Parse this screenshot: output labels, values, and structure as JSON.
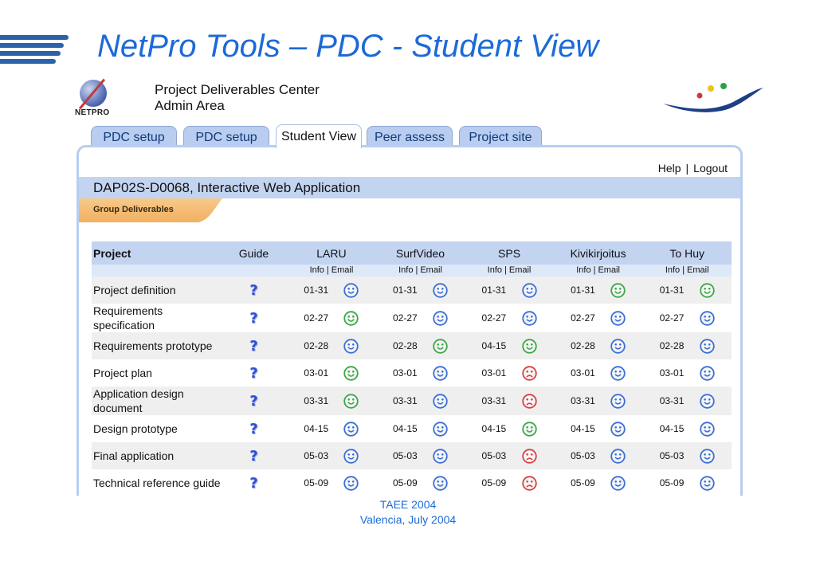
{
  "slide": {
    "title": "NetPro Tools – PDC - Student View",
    "footer_line1": "TAEE 2004",
    "footer_line2": "Valencia,  July 2004"
  },
  "app": {
    "logo_text": "NETPRO",
    "title_line1": "Project Deliverables Center",
    "title_line2": "Admin Area"
  },
  "tabs": [
    {
      "label": "PDC setup",
      "active": false
    },
    {
      "label": "PDC setup",
      "active": false
    },
    {
      "label": "Student View",
      "active": true
    },
    {
      "label": "Peer assess",
      "active": false
    },
    {
      "label": "Project site",
      "active": false
    }
  ],
  "toolbar": {
    "help": "Help",
    "separator": "|",
    "logout": "Logout"
  },
  "project": {
    "title": "DAP02S-D0068, Interactive Web Application"
  },
  "section_tab": {
    "label": "Group Deliverables"
  },
  "table": {
    "col_project": "Project",
    "col_guide": "Guide",
    "guide_icon": "?",
    "info_label": "Info",
    "email_label": "Email",
    "link_separator": "|",
    "groups": [
      "LARU",
      "SurfVideo",
      "SPS",
      "Kivikirjoitus",
      "To Huy"
    ],
    "status_colors": {
      "blue": "#3b6fd6",
      "green": "#3aa845",
      "red": "#d94040"
    },
    "rows": [
      {
        "name": "Project definition",
        "cells": [
          {
            "date": "01-31",
            "status": "blue"
          },
          {
            "date": "01-31",
            "status": "blue"
          },
          {
            "date": "01-31",
            "status": "blue"
          },
          {
            "date": "01-31",
            "status": "green"
          },
          {
            "date": "01-31",
            "status": "green"
          }
        ]
      },
      {
        "name": "Requirements specification",
        "cells": [
          {
            "date": "02-27",
            "status": "green"
          },
          {
            "date": "02-27",
            "status": "blue"
          },
          {
            "date": "02-27",
            "status": "blue"
          },
          {
            "date": "02-27",
            "status": "blue"
          },
          {
            "date": "02-27",
            "status": "blue"
          }
        ]
      },
      {
        "name": "Requirements prototype",
        "cells": [
          {
            "date": "02-28",
            "status": "blue"
          },
          {
            "date": "02-28",
            "status": "green"
          },
          {
            "date": "04-15",
            "status": "green"
          },
          {
            "date": "02-28",
            "status": "blue"
          },
          {
            "date": "02-28",
            "status": "blue"
          }
        ]
      },
      {
        "name": "Project plan",
        "cells": [
          {
            "date": "03-01",
            "status": "green"
          },
          {
            "date": "03-01",
            "status": "blue"
          },
          {
            "date": "03-01",
            "status": "red"
          },
          {
            "date": "03-01",
            "status": "blue"
          },
          {
            "date": "03-01",
            "status": "blue"
          }
        ]
      },
      {
        "name": "Application design document",
        "cells": [
          {
            "date": "03-31",
            "status": "green"
          },
          {
            "date": "03-31",
            "status": "blue"
          },
          {
            "date": "03-31",
            "status": "red"
          },
          {
            "date": "03-31",
            "status": "blue"
          },
          {
            "date": "03-31",
            "status": "blue"
          }
        ]
      },
      {
        "name": "Design prototype",
        "cells": [
          {
            "date": "04-15",
            "status": "blue"
          },
          {
            "date": "04-15",
            "status": "blue"
          },
          {
            "date": "04-15",
            "status": "green"
          },
          {
            "date": "04-15",
            "status": "blue"
          },
          {
            "date": "04-15",
            "status": "blue"
          }
        ]
      },
      {
        "name": "Final application",
        "cells": [
          {
            "date": "05-03",
            "status": "blue"
          },
          {
            "date": "05-03",
            "status": "blue"
          },
          {
            "date": "05-03",
            "status": "red"
          },
          {
            "date": "05-03",
            "status": "blue"
          },
          {
            "date": "05-03",
            "status": "blue"
          }
        ]
      },
      {
        "name": "Technical reference guide",
        "cells": [
          {
            "date": "05-09",
            "status": "blue"
          },
          {
            "date": "05-09",
            "status": "blue"
          },
          {
            "date": "05-09",
            "status": "red"
          },
          {
            "date": "05-09",
            "status": "blue"
          },
          {
            "date": "05-09",
            "status": "blue"
          }
        ]
      }
    ]
  }
}
